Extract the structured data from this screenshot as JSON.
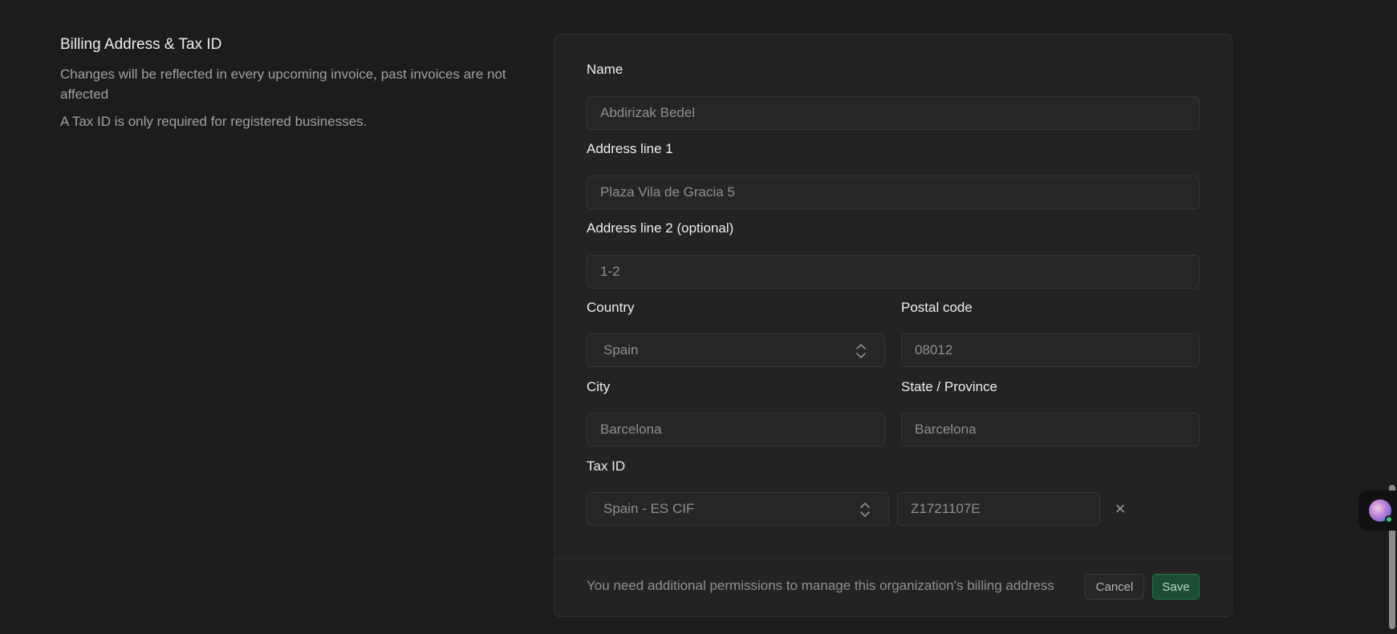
{
  "section": {
    "title": "Billing Address & Tax ID",
    "description": "Changes will be reflected in every upcoming invoice, past invoices are not affected",
    "tax_note": "A Tax ID is only required for registered businesses."
  },
  "form": {
    "name": {
      "label": "Name",
      "value": "Abdirizak Bedel"
    },
    "address1": {
      "label": "Address line 1",
      "value": "Plaza Vila de Gracia 5"
    },
    "address2": {
      "label": "Address line 2 (optional)",
      "value": "1-2"
    },
    "country": {
      "label": "Country",
      "value": "Spain"
    },
    "postal_code": {
      "label": "Postal code",
      "value": "08012"
    },
    "city": {
      "label": "City",
      "value": "Barcelona"
    },
    "state": {
      "label": "State / Province",
      "value": "Barcelona"
    },
    "tax_id": {
      "label": "Tax ID",
      "type_value": "Spain - ES CIF",
      "value": "Z1721107E",
      "clear_icon": "×"
    }
  },
  "footer": {
    "note": "You need additional permissions to manage this organization's billing address",
    "cancel_label": "Cancel",
    "save_label": "Save"
  },
  "icons": {
    "chevron": "chevron-up-down-icon",
    "clear": "close-icon",
    "avatar": "user-avatar"
  },
  "colors": {
    "background": "#1c1c1c",
    "card": "#232323",
    "save_button": "#1a4d33",
    "status_online": "#2ecc71"
  }
}
